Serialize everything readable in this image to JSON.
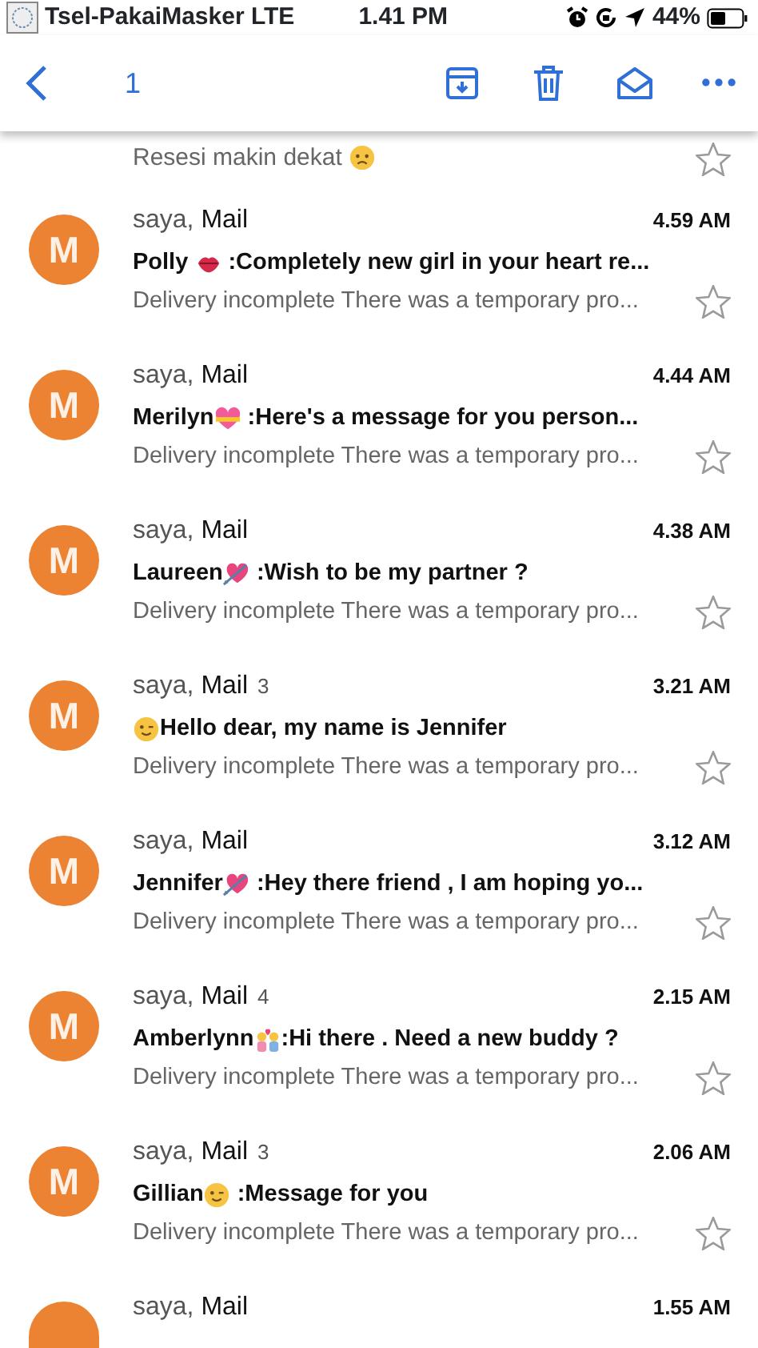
{
  "status_bar": {
    "carrier": "Tsel-PakaiMasker LTE",
    "time": "1.41 PM",
    "battery": "44%"
  },
  "toolbar": {
    "count": "1"
  },
  "partial_row": {
    "preview": [
      {
        "kind": "text",
        "text": "Resesi makin dekat"
      },
      {
        "kind": "sad"
      }
    ]
  },
  "messages": [
    {
      "avatar": "M",
      "sender_prefix": "saya,",
      "sender": "Mail",
      "time": "4.59 AM",
      "subject": [
        {
          "kind": "text",
          "text": "Polly "
        },
        {
          "kind": "lips"
        },
        {
          "kind": "text",
          "text": " :Completely new girl in your heart re..."
        }
      ],
      "preview": "Delivery incomplete There was a temporary pro..."
    },
    {
      "avatar": "M",
      "sender_prefix": "saya,",
      "sender": "Mail",
      "time": "4.44 AM",
      "subject": [
        {
          "kind": "text",
          "text": "Merilyn"
        },
        {
          "kind": "heart-ribbon"
        },
        {
          "kind": "text",
          "text": " :Here's a message for you person..."
        }
      ],
      "preview": "Delivery incomplete There was a temporary pro..."
    },
    {
      "avatar": "M",
      "sender_prefix": "saya,",
      "sender": "Mail",
      "time": "4.38 AM",
      "subject": [
        {
          "kind": "text",
          "text": "Laureen"
        },
        {
          "kind": "heart-arrow"
        },
        {
          "kind": "text",
          "text": " :Wish to be my partner ?"
        }
      ],
      "preview": "Delivery incomplete There was a temporary pro..."
    },
    {
      "avatar": "M",
      "sender_prefix": "saya,",
      "sender": "Mail",
      "count": "3",
      "time": "3.21 AM",
      "subject": [
        {
          "kind": "wink"
        },
        {
          "kind": "text",
          "text": "Hello dear, my name is Jennifer"
        }
      ],
      "preview": "Delivery incomplete There was a temporary pro..."
    },
    {
      "avatar": "M",
      "sender_prefix": "saya,",
      "sender": "Mail",
      "time": "3.12 AM",
      "subject": [
        {
          "kind": "text",
          "text": "Jennifer"
        },
        {
          "kind": "heart-arrow"
        },
        {
          "kind": "text",
          "text": " :Hey there friend , I am hoping yo..."
        }
      ],
      "preview": "Delivery incomplete There was a temporary pro..."
    },
    {
      "avatar": "M",
      "sender_prefix": "saya,",
      "sender": "Mail",
      "count": "4",
      "time": "2.15 AM",
      "subject": [
        {
          "kind": "text",
          "text": "Amberlynn"
        },
        {
          "kind": "couple-heart"
        },
        {
          "kind": "text",
          "text": ":Hi there . Need a new buddy ?"
        }
      ],
      "preview": "Delivery incomplete There was a temporary pro..."
    },
    {
      "avatar": "M",
      "sender_prefix": "saya,",
      "sender": "Mail",
      "count": "3",
      "time": "2.06 AM",
      "subject": [
        {
          "kind": "text",
          "text": "Gillian"
        },
        {
          "kind": "wink"
        },
        {
          "kind": "text",
          "text": " :Message for you"
        }
      ],
      "preview": "Delivery incomplete There was a temporary pro..."
    },
    {
      "sender_prefix": "saya,",
      "sender": "Mail",
      "time": "1.55 AM"
    }
  ]
}
